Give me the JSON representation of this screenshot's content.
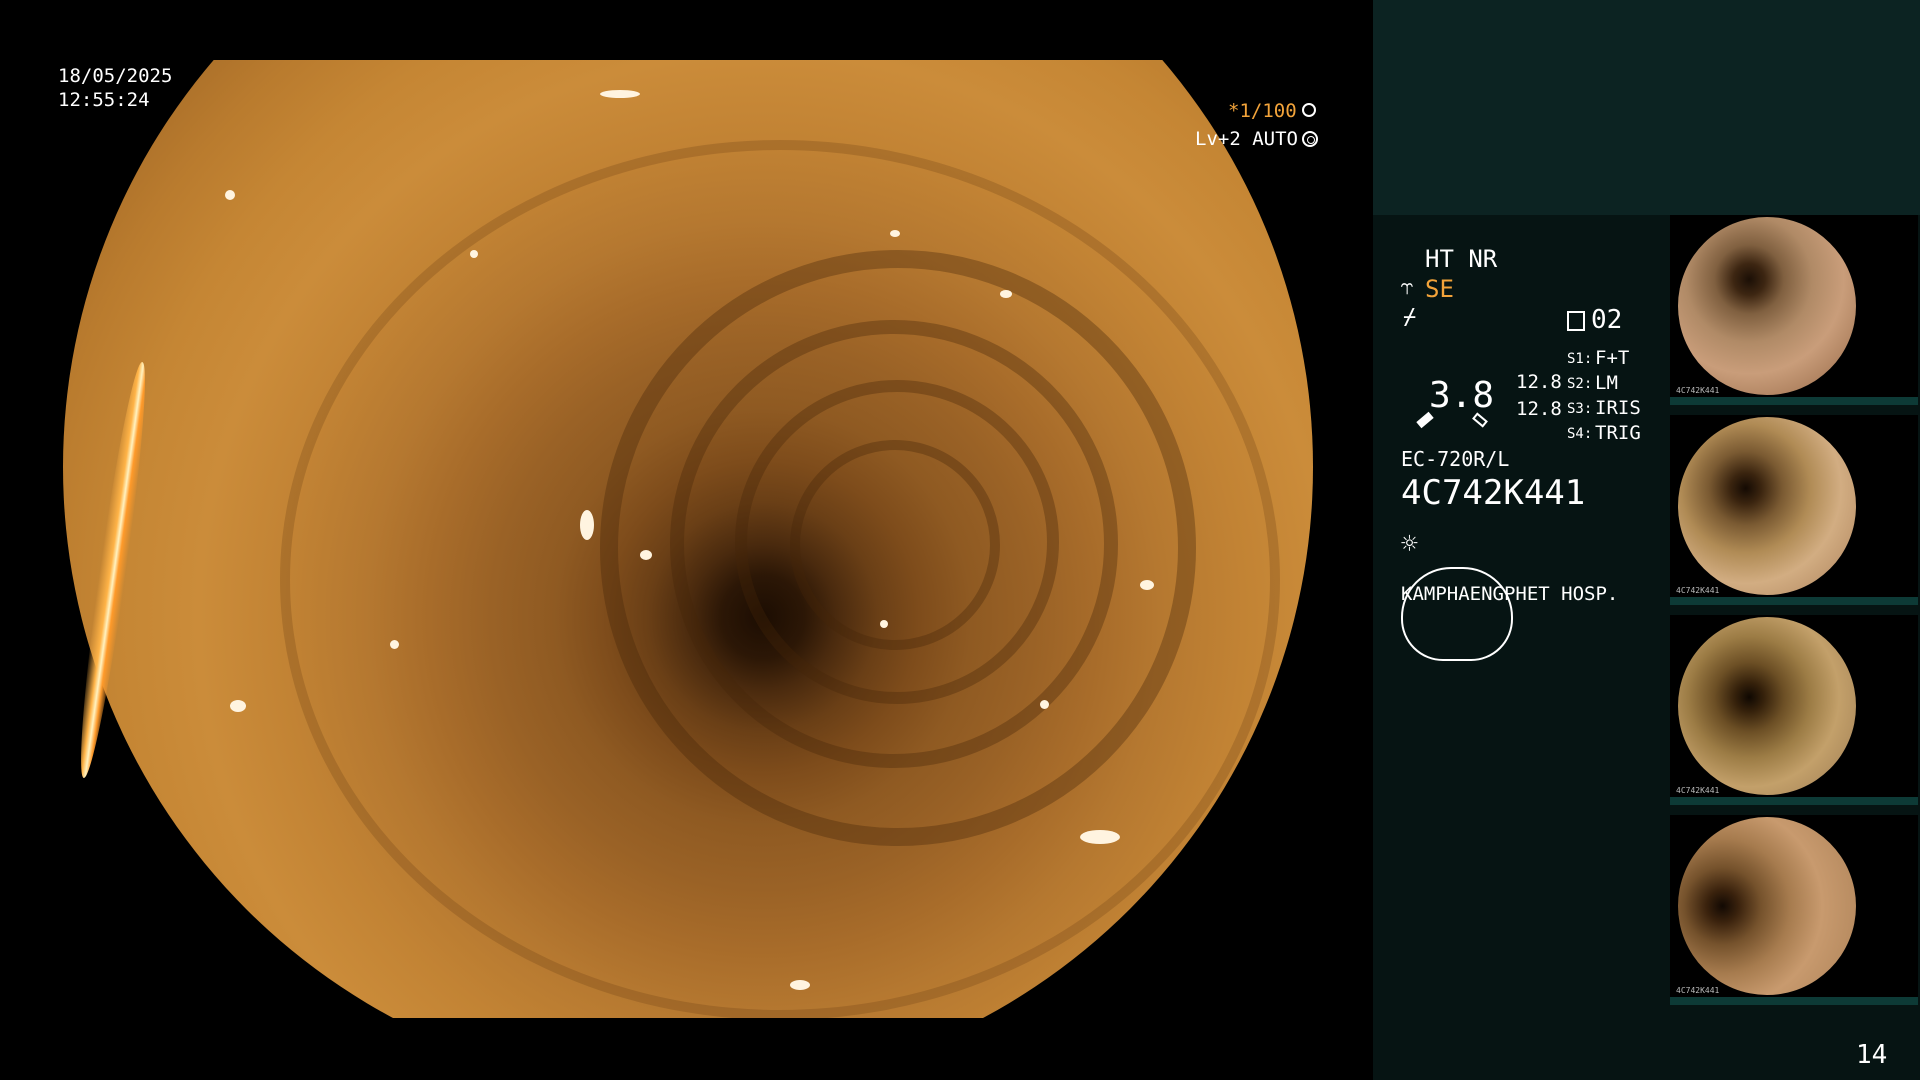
{
  "overlay": {
    "date": "18/05/2025",
    "time": "12:55:24",
    "shutter": "*1/100",
    "level": "Lv+2 AUTO",
    "shutter_icon": "aperture-icon",
    "auto_icon": "iris-icon"
  },
  "side": {
    "mode1": "HT NR",
    "mode2": "SE",
    "mode2_icon": "enhance-icon",
    "mode3_icon": "freeze-icon",
    "memory_label": "02",
    "memory_icon": "memory-card-icon",
    "gauge_value": "3.8",
    "gauge_side_top": "12.8",
    "gauge_side_bottom": "12.8",
    "switches": [
      {
        "key": "S1:",
        "value": "F+T"
      },
      {
        "key": "S2:",
        "value": "LM"
      },
      {
        "key": "S3:",
        "value": "IRIS"
      },
      {
        "key": "S4:",
        "value": "TRIG"
      }
    ],
    "scope_model": "EC-720R/L",
    "scope_serial": "4C742K441",
    "light_icon": "lamp-icon",
    "hospital": "KAMPHAENGPHET HOSP.",
    "page_number": "14"
  },
  "thumbnails": [
    {
      "label": "4C742K441"
    },
    {
      "label": "4C742K441"
    },
    {
      "label": "4C742K441"
    },
    {
      "label": "4C742K441"
    }
  ],
  "colors": {
    "accent_orange": "#f2a33a",
    "panel_dark": "#061413",
    "panel_top": "#0c2322"
  }
}
